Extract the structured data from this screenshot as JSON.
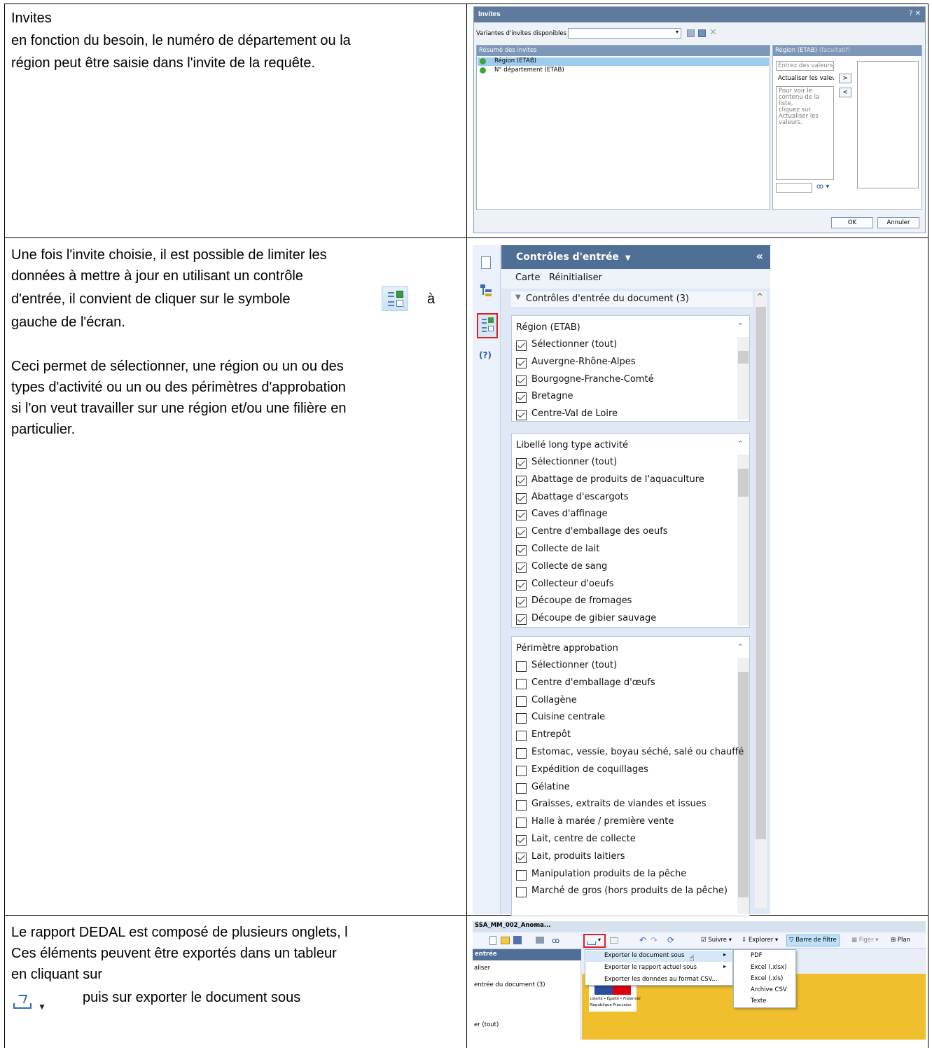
{
  "row1": {
    "heading": "Invites",
    "text_line1": "en fonction du besoin, le numéro de département ou la",
    "text_line2": "région peut être saisie dans l'invite de la requête.",
    "dialog": {
      "title": "Invites",
      "variants_label": "Variantes d'invites disponibles",
      "summary_header": "Résumé des invites",
      "prompts": [
        "Région (ETAB)",
        "N° département (ETAB)"
      ],
      "region_header": "Région (ETAB)",
      "region_header_optional": "(facultatif)",
      "enter_values_placeholder": "Entrez des valeurs",
      "refresh_button": "Actualiser les valeurs",
      "hint": [
        "Pour voir le",
        "contenu de la liste,",
        "cliquez sur",
        "Actualiser les",
        "valeurs."
      ],
      "add_arrow": ">",
      "remove_arrow": "<",
      "ok": "OK",
      "cancel": "Annuler"
    }
  },
  "row2": {
    "p1_line1": "Une fois l'invite choisie, il est possible de limiter les",
    "p1_line2": "données à mettre à jour en utilisant un contrôle",
    "p1_line3a": "d'entrée, il convient de cliquer sur le symbole",
    "p1_line3b": "à",
    "p1_line4": "gauche de l'écran.",
    "p2_line1": "Ceci permet de sélectionner, une région ou un ou des",
    "p2_line2": "types d'activité ou un ou des périmètres d'approbation",
    "p2_line3": "si l'on veut travailler sur une région et/ou une filière en",
    "p2_line4": "particulier.",
    "panel": {
      "title": "Contrôles d'entrée",
      "collapse": "«",
      "menu_map": "Carte",
      "menu_reset": "Réinitialiser",
      "section": "Contrôles d'entrée du document (3)",
      "help_icon_text": "(?)",
      "groups": [
        {
          "title": "Région (ETAB)",
          "items": [
            {
              "label": "Sélectionner (tout)",
              "checked": true
            },
            {
              "label": "Auvergne-Rhône-Alpes",
              "checked": true
            },
            {
              "label": "Bourgogne-Franche-Comté",
              "checked": true
            },
            {
              "label": "Bretagne",
              "checked": true
            },
            {
              "label": "Centre-Val de Loire",
              "checked": true
            }
          ]
        },
        {
          "title": "Libellé long type activité",
          "items": [
            {
              "label": "Sélectionner (tout)",
              "checked": true
            },
            {
              "label": "Abattage de produits de l'aquaculture",
              "checked": true
            },
            {
              "label": "Abattage d'escargots",
              "checked": true
            },
            {
              "label": "Caves d'affinage",
              "checked": true
            },
            {
              "label": "Centre d'emballage des oeufs",
              "checked": true
            },
            {
              "label": "Collecte de lait",
              "checked": true
            },
            {
              "label": "Collecte de sang",
              "checked": true
            },
            {
              "label": "Collecteur d'oeufs",
              "checked": true
            },
            {
              "label": "Découpe de fromages",
              "checked": true
            },
            {
              "label": "Découpe de gibier sauvage",
              "checked": true
            }
          ]
        },
        {
          "title": "Périmètre approbation",
          "items": [
            {
              "label": "Sélectionner (tout)",
              "checked": false
            },
            {
              "label": "Centre d'emballage d'œufs",
              "checked": false
            },
            {
              "label": "Collagène",
              "checked": false
            },
            {
              "label": "Cuisine centrale",
              "checked": false
            },
            {
              "label": "Entrepôt",
              "checked": false
            },
            {
              "label": "Estomac, vessie, boyau séché, salé ou chauffé",
              "checked": false
            },
            {
              "label": "Expédition de coquillages",
              "checked": false
            },
            {
              "label": "Gélatine",
              "checked": false
            },
            {
              "label": "Graisses, extraits de viandes et issues",
              "checked": false
            },
            {
              "label": "Halle à marée / première vente",
              "checked": false
            },
            {
              "label": "Lait, centre de collecte",
              "checked": true
            },
            {
              "label": "Lait, produits laitiers",
              "checked": true
            },
            {
              "label": "Manipulation produits de la pêche",
              "checked": false
            },
            {
              "label": "Marché de gros (hors produits de la pêche)",
              "checked": false
            }
          ]
        }
      ]
    }
  },
  "row3": {
    "line1": "Le rapport DEDAL est composé de plusieurs onglets, l",
    "line2": "Ces éléments peuvent être exportés dans un tableur",
    "line3": "en cliquant sur",
    "line4": "puis sur exporter le document sous",
    "toolbar": {
      "doc_tab": "SSA_MM_002_Anoma...",
      "follow": "Suivre",
      "explore": "Explorer",
      "filter_bar": "Barre de filtre",
      "freeze": "Figer",
      "outline": "Plan"
    },
    "side": {
      "title": "entrée",
      "reset": "aliser",
      "section": "entrée du document (3)",
      "select_all": "er (tout)"
    },
    "menu": [
      "Exporter le document sous",
      "Exporter le rapport actuel sous",
      "Exporter les données au format CSV..."
    ],
    "submenu": [
      "PDF",
      "Excel (.xlsx)",
      "Excel (.xls)",
      "Archive CSV",
      "Texte"
    ],
    "banner": {
      "motto": "Liberté • Égalité • Fraternité",
      "republic": "République Française"
    }
  }
}
